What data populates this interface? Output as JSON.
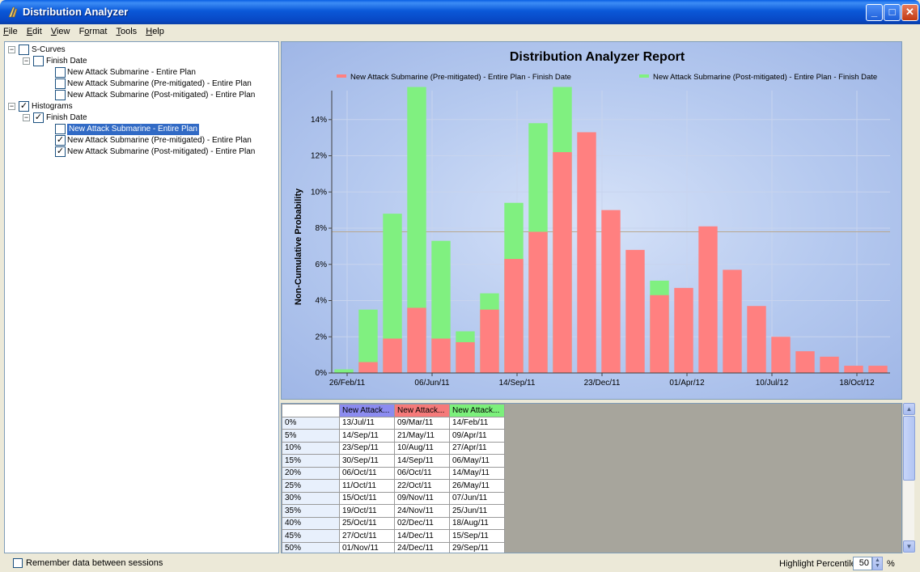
{
  "window": {
    "title": "Distribution Analyzer"
  },
  "menu": {
    "items": [
      {
        "label": "File",
        "u": "F",
        "rest": "ile"
      },
      {
        "label": "Edit",
        "u": "E",
        "rest": "dit"
      },
      {
        "label": "View",
        "u": "V",
        "rest": "iew"
      },
      {
        "label": "Format",
        "u": "",
        "pre": "F",
        "u2": "o",
        "rest": "rmat"
      },
      {
        "label": "Tools",
        "u": "T",
        "rest": "ools"
      },
      {
        "label": "Help",
        "u": "H",
        "rest": "elp"
      }
    ]
  },
  "tree": {
    "s_curves": "S-Curves",
    "s_finish": "Finish Date",
    "s_item1": "New Attack Submarine - Entire Plan",
    "s_item2": "New Attack Submarine (Pre-mitigated) - Entire Plan",
    "s_item3": "New Attack Submarine (Post-mitigated) - Entire Plan",
    "histograms": "Histograms",
    "h_finish": "Finish Date",
    "h_item1": "New Attack Submarine - Entire Plan",
    "h_item2": "New Attack Submarine (Pre-mitigated) - Entire Plan",
    "h_item3": "New Attack Submarine (Post-mitigated) - Entire Plan"
  },
  "chart_data": {
    "type": "bar",
    "title": "Distribution Analyzer Report",
    "ylabel": "Non-Cumulative Probability",
    "xlabel": "",
    "ylim": [
      0,
      15.6
    ],
    "yticks": [
      "0%",
      "2%",
      "4%",
      "6%",
      "8%",
      "10%",
      "12%",
      "14%"
    ],
    "xticks": [
      "26/Feb/11",
      "06/Jun/11",
      "14/Sep/11",
      "23/Dec/11",
      "01/Apr/12",
      "10/Jul/12",
      "18/Oct/12"
    ],
    "legend_position": "top",
    "series": [
      {
        "name": "New Attack Submarine (Pre-mitigated) - Entire Plan - Finish Date",
        "color": "#ff8080",
        "values": [
          0,
          0.6,
          1.9,
          3.6,
          1.9,
          1.7,
          3.5,
          6.3,
          7.8,
          12.2,
          13.3,
          9.0,
          6.8,
          4.3,
          4.7,
          8.1,
          5.7,
          3.7,
          2.0,
          1.2,
          0.9,
          0.4,
          0.4
        ]
      },
      {
        "name": "New Attack Submarine (Post-mitigated) - Entire Plan - Finish Date",
        "color": "#80f080",
        "values": [
          0.2,
          3.5,
          8.8,
          15.8,
          7.3,
          2.3,
          4.4,
          9.4,
          13.8,
          15.8,
          0,
          0,
          0,
          5.1,
          0,
          0,
          0,
          0,
          0,
          0,
          0,
          0,
          0
        ]
      }
    ],
    "grid": true
  },
  "grid": {
    "headers": [
      "New Attack...",
      "New Attack...",
      "New Attack..."
    ],
    "rows": [
      [
        "0%",
        "13/Jul/11",
        "09/Mar/11",
        "14/Feb/11"
      ],
      [
        "5%",
        "14/Sep/11",
        "21/May/11",
        "09/Apr/11"
      ],
      [
        "10%",
        "23/Sep/11",
        "10/Aug/11",
        "27/Apr/11"
      ],
      [
        "15%",
        "30/Sep/11",
        "14/Sep/11",
        "06/May/11"
      ],
      [
        "20%",
        "06/Oct/11",
        "06/Oct/11",
        "14/May/11"
      ],
      [
        "25%",
        "11/Oct/11",
        "22/Oct/11",
        "26/May/11"
      ],
      [
        "30%",
        "15/Oct/11",
        "09/Nov/11",
        "07/Jun/11"
      ],
      [
        "35%",
        "19/Oct/11",
        "24/Nov/11",
        "25/Jun/11"
      ],
      [
        "40%",
        "25/Oct/11",
        "02/Dec/11",
        "18/Aug/11"
      ],
      [
        "45%",
        "27/Oct/11",
        "14/Dec/11",
        "15/Sep/11"
      ],
      [
        "50%",
        "01/Nov/11",
        "24/Dec/11",
        "29/Sep/11"
      ]
    ]
  },
  "status": {
    "remember_label": "Remember data between sessions",
    "highlight_label": "Highlight Percentile:",
    "highlight_value": "50",
    "highlight_unit": "%"
  },
  "colors": {
    "selection": "#316ac5",
    "pre": "#ff8080",
    "post": "#80f080",
    "header_blue": "#8c8cf0"
  }
}
